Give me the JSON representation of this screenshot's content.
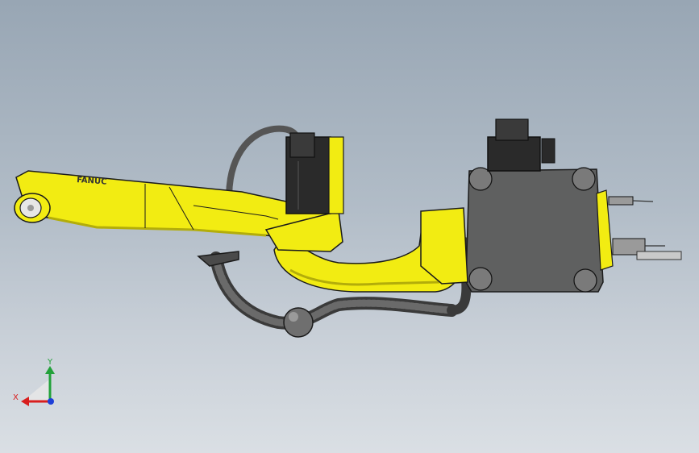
{
  "viewport": {
    "background_top": "#98a6b4",
    "background_bottom": "#dadfe4"
  },
  "model": {
    "arm_color": "#f2ec12",
    "arm_shadow": "#b3ad0a",
    "outline_color": "#1b1b1b",
    "housing_color": "#5f6060",
    "motor_color": "#2a2a2a",
    "cable_color": "#4d4d4d",
    "arm_marking": "FANUC"
  },
  "triad": {
    "x_label": "X",
    "y_label": "Y",
    "x_color": "#d81e1e",
    "y_color": "#22a13a",
    "z_color": "#1e3fd8"
  }
}
